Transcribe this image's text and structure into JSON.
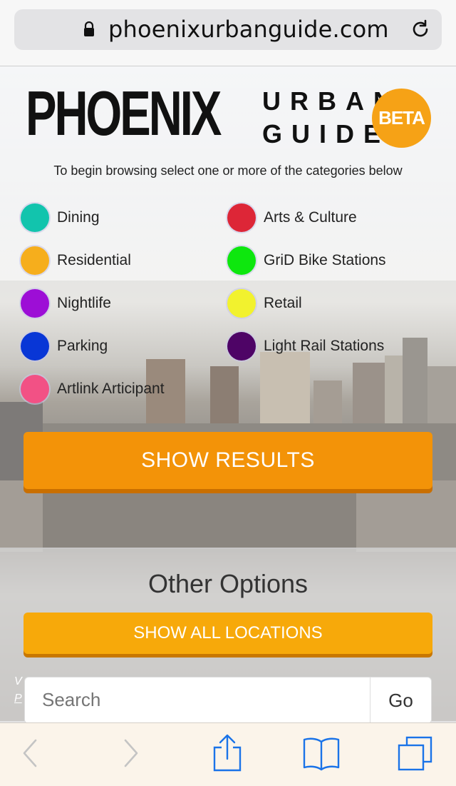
{
  "browser": {
    "url": "phoenixurbanguide.com"
  },
  "logo": {
    "main": "PHOENIX",
    "line1": "URBAN",
    "line2": "GUIDE",
    "badge": "BETA"
  },
  "intro": "To begin browsing select one or more of the categories below",
  "categories": [
    {
      "label": "Dining",
      "color": "#12c4ad"
    },
    {
      "label": "Arts & Culture",
      "color": "#dd2637"
    },
    {
      "label": "Residential",
      "color": "#f6ae1c"
    },
    {
      "label": "GriD Bike Stations",
      "color": "#0ee70e"
    },
    {
      "label": "Nightlife",
      "color": "#9d0ed6"
    },
    {
      "label": "Retail",
      "color": "#f2f22e"
    },
    {
      "label": "Parking",
      "color": "#0836d6"
    },
    {
      "label": "Light Rail Stations",
      "color": "#4e0466"
    },
    {
      "label": "Artlink Articipant",
      "color": "#f25185"
    }
  ],
  "show_results_label": "SHOW RESULTS",
  "other_options": {
    "title": "Other Options",
    "show_all_label": "SHOW ALL LOCATIONS"
  },
  "search": {
    "placeholder": "Search",
    "go_label": "Go"
  },
  "partial_text": {
    "v": "V",
    "p": "P"
  },
  "colors": {
    "accent_orange": "#f39308",
    "ios_blue": "#1a73e8"
  }
}
